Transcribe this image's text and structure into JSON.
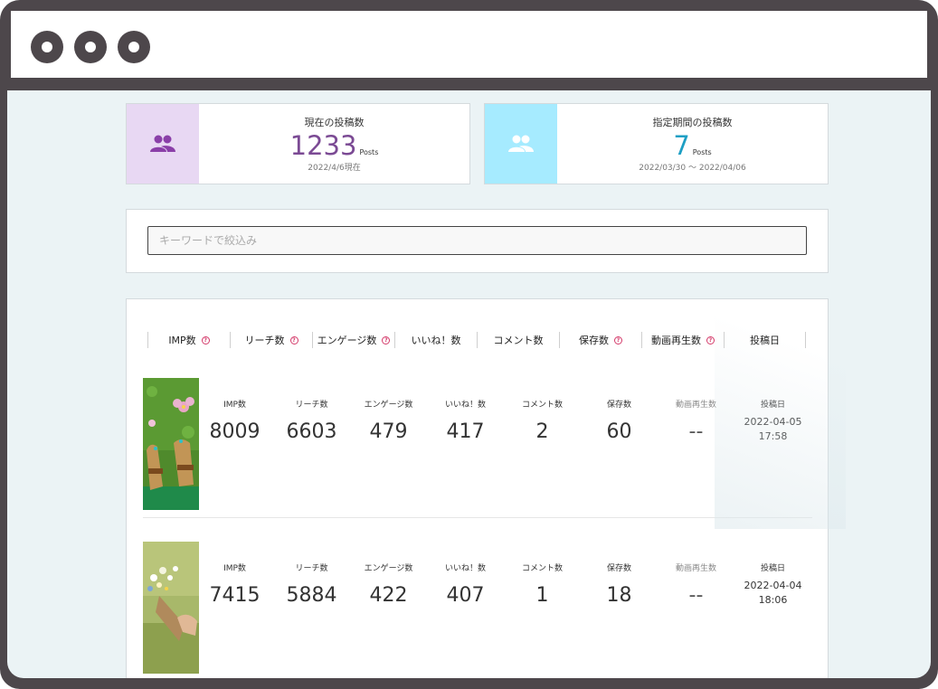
{
  "stats": {
    "current": {
      "title": "現在の投稿数",
      "value": "1233",
      "unit": "Posts",
      "sub": "2022/4/6現在",
      "icon": "people-icon",
      "icon_bg": "#e8d8f3",
      "icon_color": "#8a3fa8",
      "value_color": "#7b4a94"
    },
    "period": {
      "title": "指定期間の投稿数",
      "value": "7",
      "unit": "Posts",
      "sub": "2022/03/30 〜 2022/04/06",
      "icon": "people-icon",
      "icon_bg": "#a6ebff",
      "icon_color": "#ffffff",
      "value_color": "#1e9fc4"
    }
  },
  "search": {
    "placeholder": "キーワードで絞込み",
    "value": ""
  },
  "table": {
    "headers": [
      {
        "label": "IMP数",
        "help": true
      },
      {
        "label": "リーチ数",
        "help": true
      },
      {
        "label": "エンゲージ数",
        "help": true
      },
      {
        "label": "いいね！数",
        "help": false
      },
      {
        "label": "コメント数",
        "help": false
      },
      {
        "label": "保存数",
        "help": true
      },
      {
        "label": "動画再生数",
        "help": true
      },
      {
        "label": "投稿日",
        "help": false
      }
    ],
    "rows": [
      {
        "metrics": [
          {
            "label": "IMP数",
            "value": "8009"
          },
          {
            "label": "リーチ数",
            "value": "6603"
          },
          {
            "label": "エンゲージ数",
            "value": "479"
          },
          {
            "label": "いいね！数",
            "value": "417"
          },
          {
            "label": "コメント数",
            "value": "2"
          },
          {
            "label": "保存数",
            "value": "60"
          },
          {
            "label": "動画再生数",
            "value": "--"
          }
        ],
        "date_label": "投稿日",
        "date": "2022-04-05",
        "time": "17:58"
      },
      {
        "metrics": [
          {
            "label": "IMP数",
            "value": "7415"
          },
          {
            "label": "リーチ数",
            "value": "5884"
          },
          {
            "label": "エンゲージ数",
            "value": "422"
          },
          {
            "label": "いいね！数",
            "value": "407"
          },
          {
            "label": "コメント数",
            "value": "1"
          },
          {
            "label": "保存数",
            "value": "18"
          },
          {
            "label": "動画再生数",
            "value": "--"
          }
        ],
        "date_label": "投稿日",
        "date": "2022-04-04",
        "time": "18:06"
      }
    ]
  },
  "window": {
    "controls": [
      "window-dot-icon",
      "window-dot-icon",
      "window-dot-icon"
    ],
    "frame_color": "#4d474b"
  }
}
